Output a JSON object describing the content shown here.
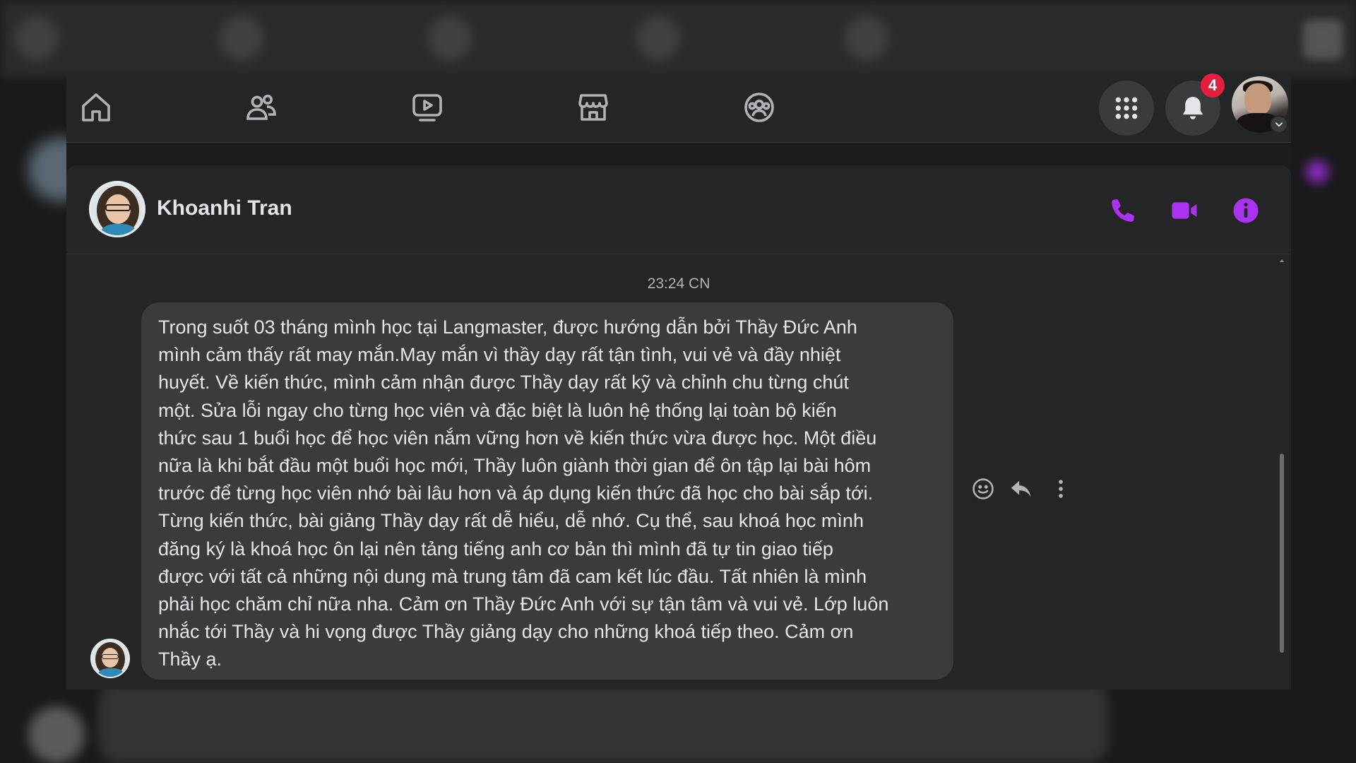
{
  "nav": {
    "items": [
      {
        "name": "home-icon"
      },
      {
        "name": "friends-icon"
      },
      {
        "name": "watch-icon"
      },
      {
        "name": "marketplace-icon"
      },
      {
        "name": "groups-icon"
      }
    ],
    "menu_icon": "grid-menu-icon",
    "notifications_icon": "bell-icon",
    "notifications_count": "4"
  },
  "chat": {
    "contact_name": "Khoanhi Tran",
    "header_actions": [
      "phone-icon",
      "video-camera-icon",
      "info-icon"
    ],
    "accent_color": "#a933f0",
    "timestamp": "23:24 CN",
    "message": {
      "lines": [
        "Trong suốt 03 tháng mình học tại Langmaster, được hướng dẫn bởi Thầy Đức Anh",
        "mình cảm thấy rất may mắn.May mắn vì thầy dạy rất tận tình, vui vẻ và đầy nhiệt",
        "huyết. Về kiến thức, mình cảm nhận được Thầy dạy rất kỹ và chỉnh chu từng chút",
        "một. Sửa lỗi ngay cho từng học viên và đặc biệt là luôn hệ thống lại toàn bộ kiến",
        "thức sau 1 buổi học để học viên nắm vững hơn về kiến thức vừa được học. Một điều",
        "nữa là khi bắt đầu một buổi học mới, Thầy luôn giành thời gian để ôn tập lại bài hôm",
        "trước để từng học viên nhớ bài lâu hơn và áp dụng kiến thức đã học cho bài sắp tới.",
        "Từng kiến thức, bài giảng Thầy dạy rất dễ hiểu, dễ nhớ. Cụ thể, sau khoá học mình",
        "đăng ký là khoá học ôn lại nên tảng tiếng anh cơ bản thì mình đã tự tin giao tiếp",
        "được với tất cả những nội dung mà trung tâm đã cam kết lúc đầu. Tất nhiên là mình",
        "phải học chăm chỉ nữa nha. Cảm ơn Thầy Đức Anh với sự tận tâm và vui vẻ. Lớp luôn",
        "nhắc tới Thầy và hi vọng được Thầy giảng dạy cho những khoá tiếp theo. Cảm ơn",
        "Thầy ạ."
      ],
      "actions": [
        "emoji-react-icon",
        "reply-icon",
        "more-options-icon"
      ]
    }
  }
}
